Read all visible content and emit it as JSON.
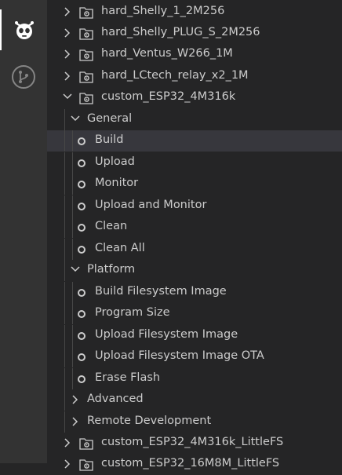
{
  "activity_bar": {
    "items": [
      {
        "name": "platformio-icon",
        "active": true
      },
      {
        "name": "git-branch-icon",
        "active": false
      }
    ]
  },
  "tree": {
    "environments_top": [
      {
        "label": "hard_Shelly_1_2M256"
      },
      {
        "label": "hard_Shelly_PLUG_S_2M256"
      },
      {
        "label": "hard_Ventus_W266_1M"
      },
      {
        "label": "hard_LCtech_relay_x2_1M"
      }
    ],
    "expanded_env": {
      "label": "custom_ESP32_4M316k",
      "groups": [
        {
          "label": "General",
          "tasks": [
            {
              "label": "Build",
              "selected": true
            },
            {
              "label": "Upload"
            },
            {
              "label": "Monitor"
            },
            {
              "label": "Upload and Monitor"
            },
            {
              "label": "Clean"
            },
            {
              "label": "Clean All"
            }
          ]
        },
        {
          "label": "Platform",
          "tasks": [
            {
              "label": "Build Filesystem Image"
            },
            {
              "label": "Program Size"
            },
            {
              "label": "Upload Filesystem Image"
            },
            {
              "label": "Upload Filesystem Image OTA"
            },
            {
              "label": "Erase Flash"
            }
          ]
        }
      ],
      "collapsed_groups": [
        {
          "label": "Advanced"
        },
        {
          "label": "Remote Development"
        }
      ]
    },
    "environments_bottom": [
      {
        "label": "custom_ESP32_4M316k_LittleFS"
      },
      {
        "label": "custom_ESP32_16M8M_LittleFS"
      }
    ]
  }
}
